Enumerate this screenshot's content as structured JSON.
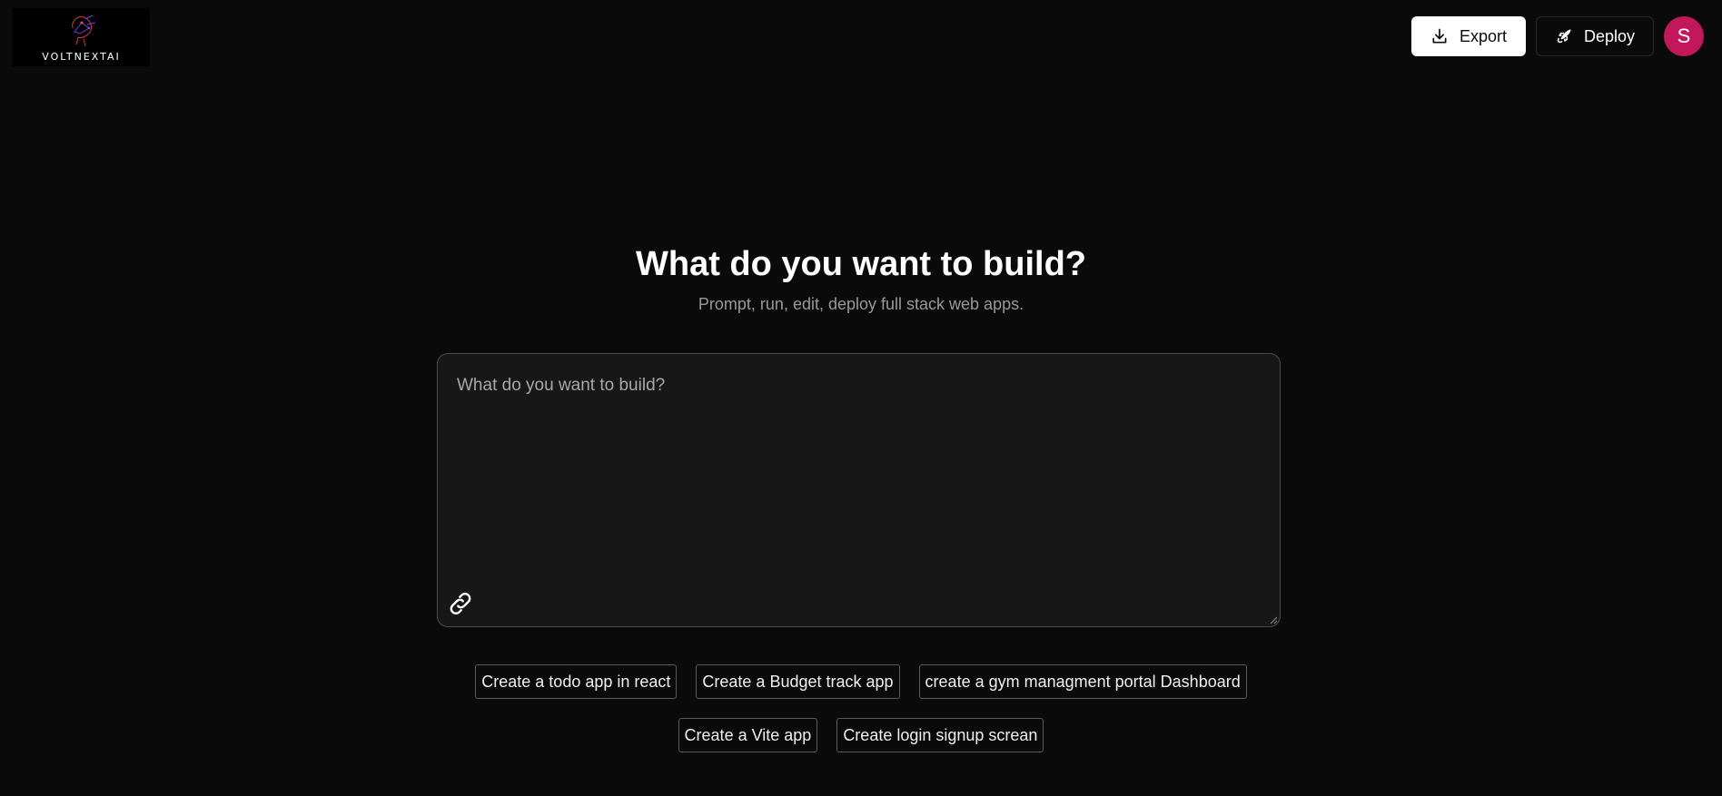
{
  "brand": {
    "logo_text": "VOLTNEXTAI"
  },
  "header": {
    "export_label": "Export",
    "deploy_label": "Deploy",
    "avatar_initial": "S",
    "avatar_color": "#c2185b"
  },
  "hero": {
    "title": "What do you want to build?",
    "subtitle": "Prompt, run, edit, deploy full stack web apps."
  },
  "prompt": {
    "placeholder": "What do you want to build?",
    "value": ""
  },
  "suggestions": {
    "row1": [
      "Create a todo app in react",
      "Create a Budget track app",
      "create a gym managment portal Dashboard"
    ],
    "row2": [
      "Create a Vite app",
      "Create login signup screan"
    ]
  },
  "icons": {
    "export": "download-icon",
    "deploy": "rocket-icon",
    "attach": "link-icon"
  }
}
